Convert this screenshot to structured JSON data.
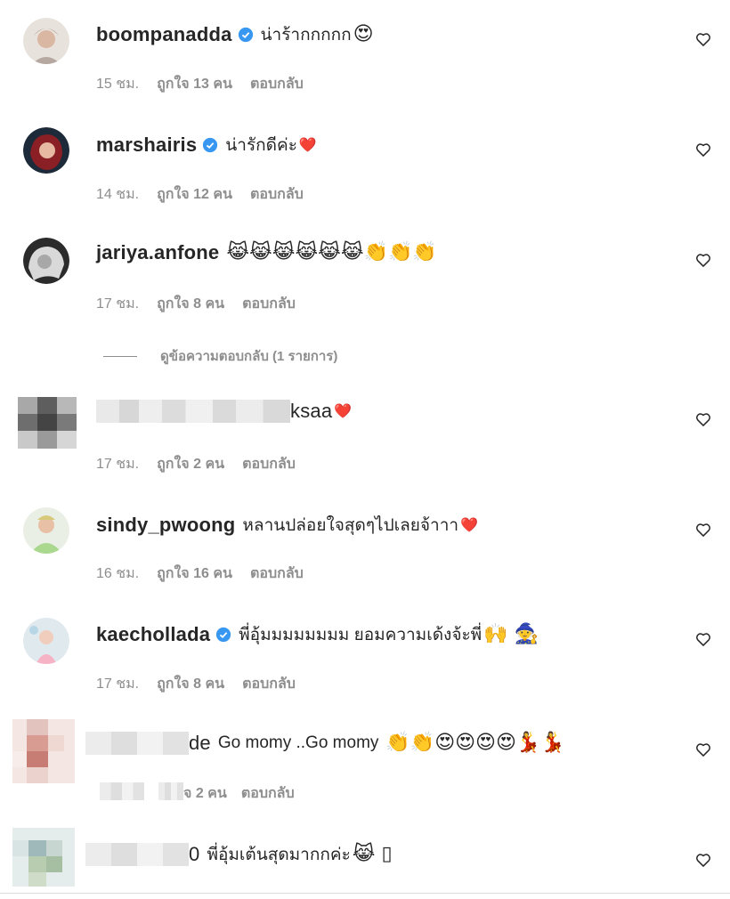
{
  "actions": {
    "reply": "ตอบกลับ"
  },
  "view_replies": "ดูข้อความตอบกลับ (1 รายการ)",
  "comments": [
    {
      "username": "boompanadda",
      "verified": true,
      "text": "น่าร้ากกกกก",
      "emoji": "😍",
      "time": "15 ชม.",
      "likes": "ถูกใจ 13 คน"
    },
    {
      "username": "marshairis",
      "verified": true,
      "text": "น่ารักดีค่ะ",
      "emoji": "❤️",
      "time": "14 ชม.",
      "likes": "ถูกใจ 12 คน"
    },
    {
      "username": "jariya.anfone",
      "verified": false,
      "text": "",
      "emoji": "😹😹😹😹😹😹👏👏👏",
      "time": "17 ชม.",
      "likes": "ถูกใจ 8 คน"
    },
    {
      "username": "ksaa",
      "verified": false,
      "text": "",
      "emoji": "❤️",
      "time": "17 ชม.",
      "likes": "ถูกใจ 2 คน"
    },
    {
      "username": "sindy_pwoong",
      "verified": false,
      "text": "หลานปล่อยใจสุดๆไปเลยจ้าาา",
      "emoji": "❤️",
      "time": "16 ชม.",
      "likes": "ถูกใจ 16 คน"
    },
    {
      "username": "kaechollada",
      "verified": true,
      "text": "พี่อุ้มมมมมมมม ยอมความเด้งจ้ะพี่",
      "emoji": "🙌 🧙",
      "time": "17 ชม.",
      "likes": "ถูกใจ 8 คน"
    },
    {
      "username": "de",
      "verified": false,
      "text": "Go momy ..Go momy",
      "emoji": "👏👏😍😍😍😍💃💃",
      "time": "",
      "likes": "จ 2 คน"
    },
    {
      "username": "0",
      "verified": false,
      "text": "พี่อุ้มเต้นสุดมากกค่ะ",
      "emoji": "😹 ▯",
      "time": "",
      "likes": ""
    }
  ]
}
